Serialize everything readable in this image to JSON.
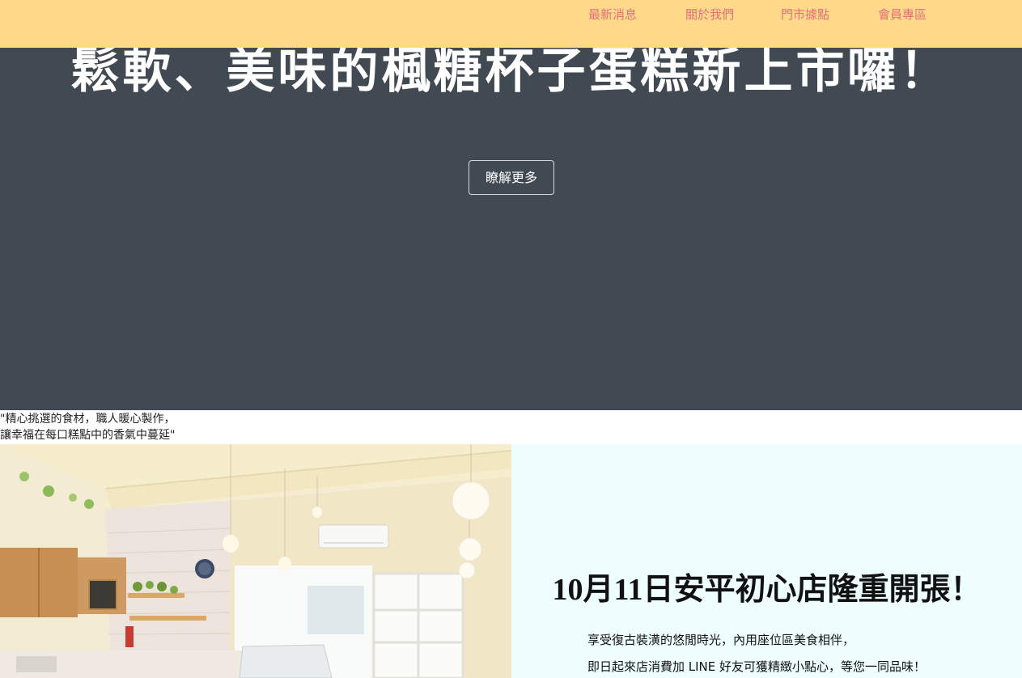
{
  "nav": {
    "items": [
      "最新消息",
      "關於我們",
      "門市據點",
      "會員專區"
    ]
  },
  "hero": {
    "title": "鬆軟、美味的楓糖杯子蛋糕新上市囉！",
    "subtitle": "",
    "button_label": "瞭解更多"
  },
  "quote": {
    "line1": "\"精心挑選的食材，職人暖心製作，",
    "line2": "讓幸福在每口糕點中的香氣中蔓延\""
  },
  "promo": {
    "title": "10月11日安平初心店隆重開張！",
    "line1": "享受復古裝潢的悠閒時光，內用座位區美食相伴，",
    "line2": "即日起來店消費加 LINE 好友可獲精緻小點心，等您一同品味！"
  },
  "colors": {
    "nav_bg": "#ffd98a",
    "nav_link": "#e0707a",
    "hero_bg": "#414a53",
    "info_bg": "#eefefe"
  }
}
